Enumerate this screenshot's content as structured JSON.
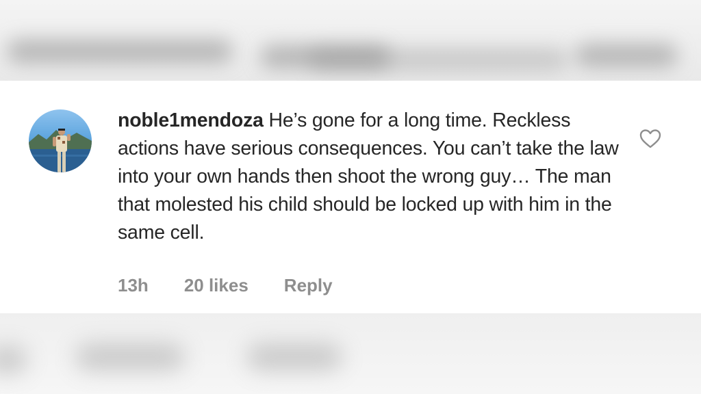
{
  "comment": {
    "username": "noble1mendoza",
    "text": "He’s gone for a long time. Reckless actions have serious consequences. You can’t take the law into your own hands then shoot the wrong guy… The man that molested his child should be locked up with him in the same cell.",
    "timestamp": "13h",
    "likes": "20 likes",
    "reply_label": "Reply"
  },
  "icons": {
    "like": "heart-outline-icon",
    "avatar": "profile-photo"
  },
  "colors": {
    "text": "#262626",
    "meta": "#8e8e8e",
    "panel": "#ffffff"
  }
}
